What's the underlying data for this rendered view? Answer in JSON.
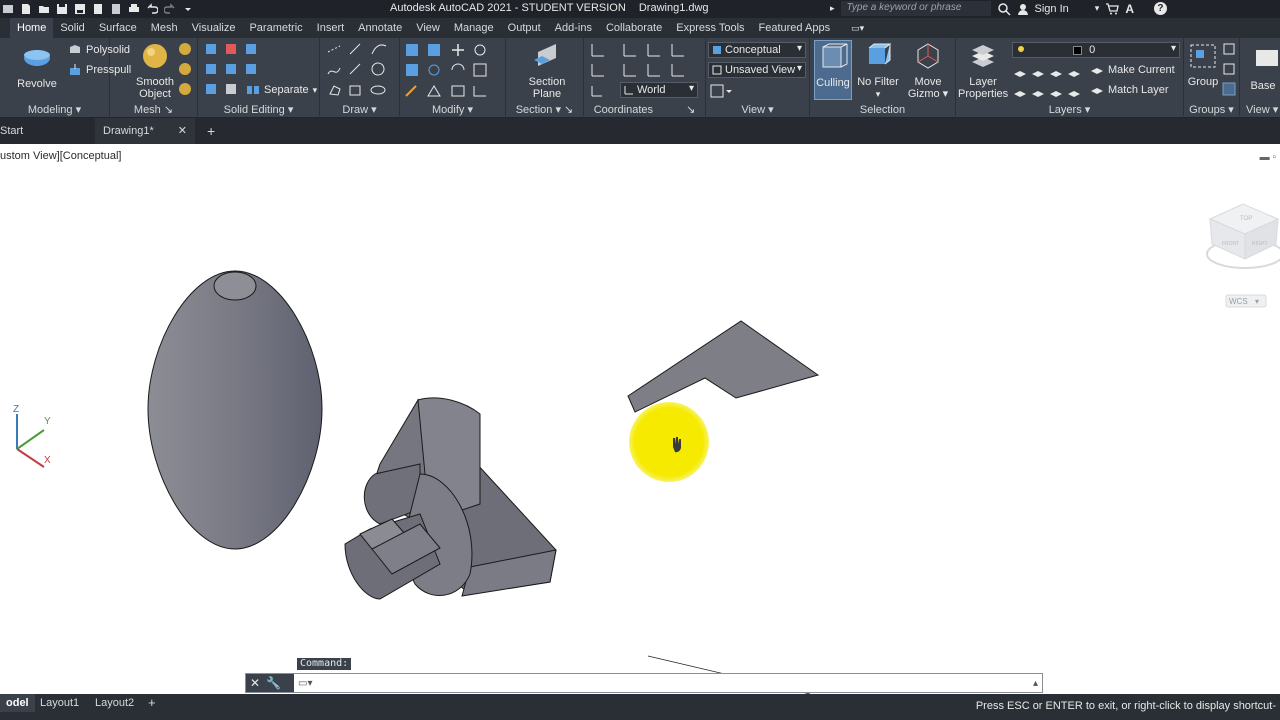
{
  "title_bar": {
    "app_title": "Autodesk AutoCAD 2021 - STUDENT VERSION",
    "file_name": "Drawing1.dwg",
    "search_placeholder": "Type a keyword or phrase",
    "sign_in": "Sign In"
  },
  "ribbon_tabs": [
    "Home",
    "Solid",
    "Surface",
    "Mesh",
    "Visualize",
    "Parametric",
    "Insert",
    "Annotate",
    "View",
    "Manage",
    "Output",
    "Add-ins",
    "Collaborate",
    "Express Tools",
    "Featured Apps"
  ],
  "active_tab": "Home",
  "panels": {
    "modeling": {
      "title": "Modeling",
      "revolve": "Revolve",
      "polysolid": "Polysolid",
      "presspull": "Presspull"
    },
    "mesh": {
      "title": "Mesh",
      "smooth_object_1": "Smooth",
      "smooth_object_2": "Object"
    },
    "solid_editing": {
      "title": "Solid Editing",
      "separate": "Separate"
    },
    "draw": {
      "title": "Draw"
    },
    "modify": {
      "title": "Modify"
    },
    "section": {
      "title": "Section",
      "section_plane_1": "Section",
      "section_plane_2": "Plane"
    },
    "coordinates": {
      "title": "Coordinates",
      "world": "World"
    },
    "view": {
      "title": "View",
      "visual_style": "Conceptual",
      "named_view": "Unsaved View"
    },
    "selection": {
      "title": "Selection",
      "culling": "Culling",
      "no_filter": "No Filter",
      "move_gizmo_1": "Move",
      "move_gizmo_2": "Gizmo"
    },
    "layers": {
      "title": "Layers",
      "layer_properties_1": "Layer",
      "layer_properties_2": "Properties",
      "current_layer": "0",
      "make_current": "Make Current",
      "match_layer": "Match Layer"
    },
    "groups": {
      "title": "Groups",
      "group": "Group"
    },
    "view2": {
      "title": "View",
      "base": "Base"
    }
  },
  "file_tabs": {
    "start": "Start",
    "drawing": "Drawing1*",
    "new_tab": "+"
  },
  "viewport": {
    "label": "ustom View][Conceptual]",
    "viewcube_top": "TOP",
    "viewcube_front": "FRONT",
    "viewcube_right": "RIGHT",
    "wcs": "WCS",
    "ucs_x": "X",
    "ucs_y": "Y",
    "ucs_z": "Z"
  },
  "command": {
    "label": "Command:",
    "input": ""
  },
  "status_bar": {
    "model": "odel",
    "layout1": "Layout1",
    "layout2": "Layout2",
    "add": "+",
    "message": "Press ESC or ENTER to exit, or right-click to display shortcut-"
  },
  "colors": {
    "ribbon_bg": "#3b414a",
    "titlebar_bg": "#1f2329",
    "solid_fill": "#7e7f86",
    "cursor_highlight": "#f5ea00"
  }
}
